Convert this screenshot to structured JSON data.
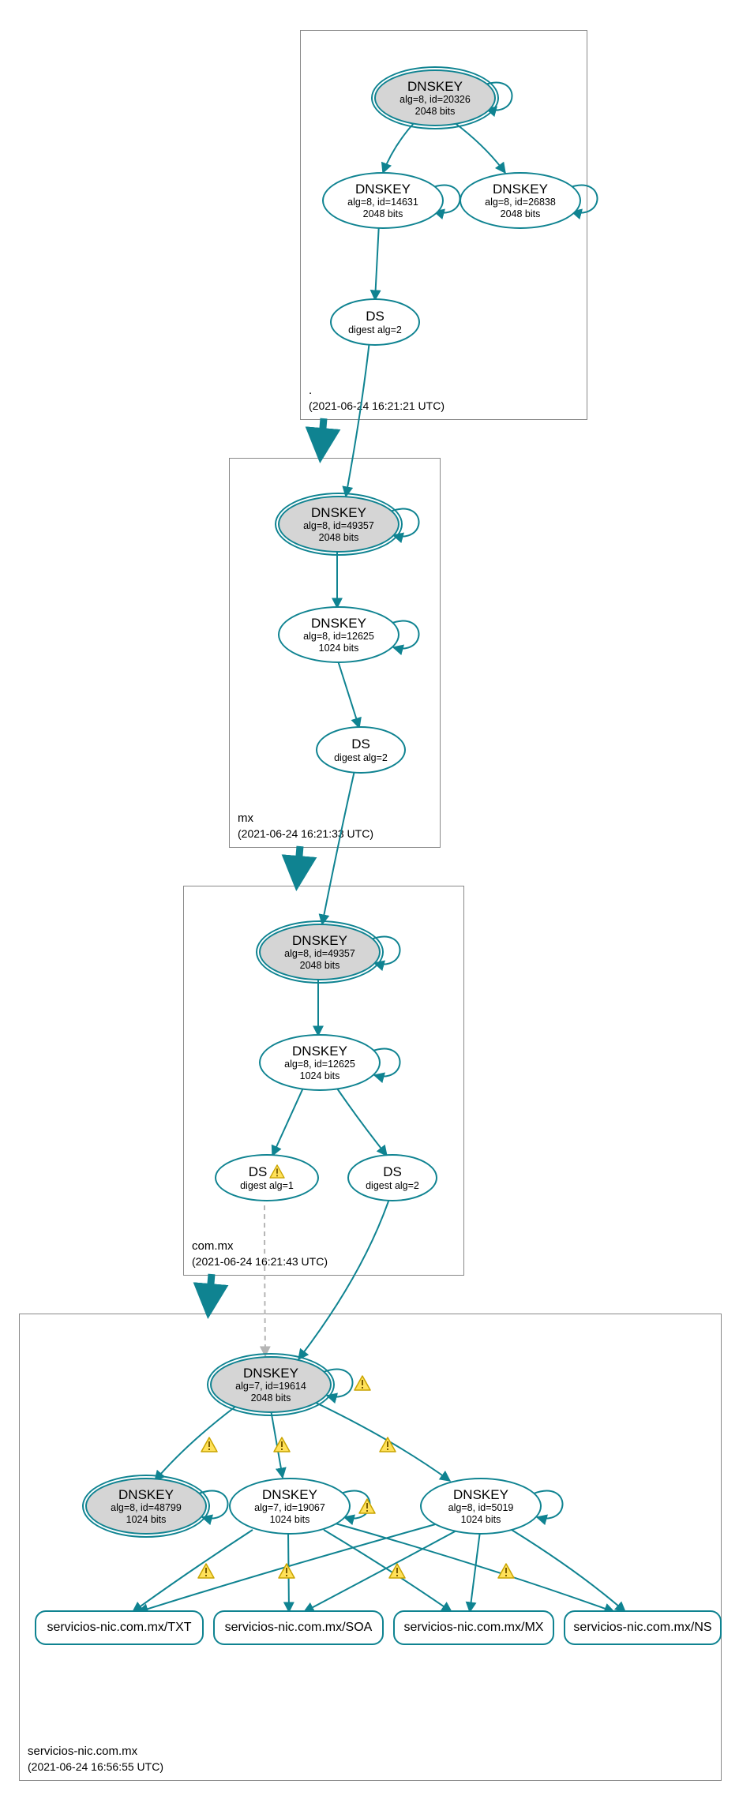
{
  "zones": {
    "root": {
      "name": ".",
      "time": "(2021-06-24 16:21:21 UTC)"
    },
    "mx": {
      "name": "mx",
      "time": "(2021-06-24 16:21:33 UTC)"
    },
    "commx": {
      "name": "com.mx",
      "time": "(2021-06-24 16:21:43 UTC)"
    },
    "leaf": {
      "name": "servicios-nic.com.mx",
      "time": "(2021-06-24 16:56:55 UTC)"
    }
  },
  "nodes": {
    "root_ksk": {
      "title": "DNSKEY",
      "line2": "alg=8, id=20326",
      "line3": "2048 bits"
    },
    "root_zsk1": {
      "title": "DNSKEY",
      "line2": "alg=8, id=14631",
      "line3": "2048 bits"
    },
    "root_zsk2": {
      "title": "DNSKEY",
      "line2": "alg=8, id=26838",
      "line3": "2048 bits"
    },
    "root_ds": {
      "title": "DS",
      "line2": "digest alg=2"
    },
    "mx_ksk": {
      "title": "DNSKEY",
      "line2": "alg=8, id=49357",
      "line3": "2048 bits"
    },
    "mx_zsk": {
      "title": "DNSKEY",
      "line2": "alg=8, id=12625",
      "line3": "1024 bits"
    },
    "mx_ds": {
      "title": "DS",
      "line2": "digest alg=2"
    },
    "commx_ksk": {
      "title": "DNSKEY",
      "line2": "alg=8, id=49357",
      "line3": "2048 bits"
    },
    "commx_zsk": {
      "title": "DNSKEY",
      "line2": "alg=8, id=12625",
      "line3": "1024 bits"
    },
    "commx_ds1": {
      "title": "DS",
      "line2": "digest alg=1",
      "warn": true
    },
    "commx_ds2": {
      "title": "DS",
      "line2": "digest alg=2"
    },
    "leaf_ksk": {
      "title": "DNSKEY",
      "line2": "alg=7, id=19614",
      "line3": "2048 bits"
    },
    "leaf_k1": {
      "title": "DNSKEY",
      "line2": "alg=8, id=48799",
      "line3": "1024 bits"
    },
    "leaf_k2": {
      "title": "DNSKEY",
      "line2": "alg=7, id=19067",
      "line3": "1024 bits"
    },
    "leaf_k3": {
      "title": "DNSKEY",
      "line2": "alg=8, id=5019",
      "line3": "1024 bits"
    },
    "rec_txt": {
      "title": "servicios-nic.com.mx/TXT"
    },
    "rec_soa": {
      "title": "servicios-nic.com.mx/SOA"
    },
    "rec_mx": {
      "title": "servicios-nic.com.mx/MX"
    },
    "rec_ns": {
      "title": "servicios-nic.com.mx/NS"
    }
  },
  "colors": {
    "teal": "#0f8391",
    "gray": "#b5b5b5",
    "warn_fill": "#ffe15a",
    "warn_stroke": "#c9a400"
  },
  "chart_data": {
    "type": "graph",
    "description": "DNSSEC authentication chain / delegation graph",
    "zones": [
      {
        "name": ".",
        "timestamp": "2021-06-24 16:21:21 UTC"
      },
      {
        "name": "mx",
        "timestamp": "2021-06-24 16:21:33 UTC"
      },
      {
        "name": "com.mx",
        "timestamp": "2021-06-24 16:21:43 UTC"
      },
      {
        "name": "servicios-nic.com.mx",
        "timestamp": "2021-06-24 16:56:55 UTC"
      }
    ],
    "nodes": [
      {
        "id": "root_ksk",
        "zone": ".",
        "type": "DNSKEY",
        "alg": 8,
        "key_id": 20326,
        "bits": 2048,
        "ksk": true
      },
      {
        "id": "root_zsk1",
        "zone": ".",
        "type": "DNSKEY",
        "alg": 8,
        "key_id": 14631,
        "bits": 2048
      },
      {
        "id": "root_zsk2",
        "zone": ".",
        "type": "DNSKEY",
        "alg": 8,
        "key_id": 26838,
        "bits": 2048
      },
      {
        "id": "root_ds",
        "zone": ".",
        "type": "DS",
        "digest_alg": 2
      },
      {
        "id": "mx_ksk",
        "zone": "mx",
        "type": "DNSKEY",
        "alg": 8,
        "key_id": 49357,
        "bits": 2048,
        "ksk": true
      },
      {
        "id": "mx_zsk",
        "zone": "mx",
        "type": "DNSKEY",
        "alg": 8,
        "key_id": 12625,
        "bits": 1024
      },
      {
        "id": "mx_ds",
        "zone": "mx",
        "type": "DS",
        "digest_alg": 2
      },
      {
        "id": "commx_ksk",
        "zone": "com.mx",
        "type": "DNSKEY",
        "alg": 8,
        "key_id": 49357,
        "bits": 2048,
        "ksk": true
      },
      {
        "id": "commx_zsk",
        "zone": "com.mx",
        "type": "DNSKEY",
        "alg": 8,
        "key_id": 12625,
        "bits": 1024
      },
      {
        "id": "commx_ds1",
        "zone": "com.mx",
        "type": "DS",
        "digest_alg": 1,
        "warning": true
      },
      {
        "id": "commx_ds2",
        "zone": "com.mx",
        "type": "DS",
        "digest_alg": 2
      },
      {
        "id": "leaf_ksk",
        "zone": "servicios-nic.com.mx",
        "type": "DNSKEY",
        "alg": 7,
        "key_id": 19614,
        "bits": 2048,
        "ksk": true
      },
      {
        "id": "leaf_k1",
        "zone": "servicios-nic.com.mx",
        "type": "DNSKEY",
        "alg": 8,
        "key_id": 48799,
        "bits": 1024,
        "ksk_style": true
      },
      {
        "id": "leaf_k2",
        "zone": "servicios-nic.com.mx",
        "type": "DNSKEY",
        "alg": 7,
        "key_id": 19067,
        "bits": 1024
      },
      {
        "id": "leaf_k3",
        "zone": "servicios-nic.com.mx",
        "type": "DNSKEY",
        "alg": 8,
        "key_id": 5019,
        "bits": 1024
      },
      {
        "id": "rec_txt",
        "zone": "servicios-nic.com.mx",
        "type": "RRset",
        "name": "servicios-nic.com.mx/TXT"
      },
      {
        "id": "rec_soa",
        "zone": "servicios-nic.com.mx",
        "type": "RRset",
        "name": "servicios-nic.com.mx/SOA"
      },
      {
        "id": "rec_mx",
        "zone": "servicios-nic.com.mx",
        "type": "RRset",
        "name": "servicios-nic.com.mx/MX"
      },
      {
        "id": "rec_ns",
        "zone": "servicios-nic.com.mx",
        "type": "RRset",
        "name": "servicios-nic.com.mx/NS"
      }
    ],
    "self_loops": [
      "root_ksk",
      "root_zsk1",
      "root_zsk2",
      "mx_ksk",
      "mx_zsk",
      "commx_ksk",
      "commx_zsk",
      "leaf_ksk",
      "leaf_k1",
      "leaf_k2",
      "leaf_k3"
    ],
    "edges": [
      {
        "from": "root_ksk",
        "to": "root_zsk1"
      },
      {
        "from": "root_ksk",
        "to": "root_zsk2"
      },
      {
        "from": "root_zsk1",
        "to": "root_ds"
      },
      {
        "from": "root_ds",
        "to": "mx_ksk"
      },
      {
        "from": "mx_ksk",
        "to": "mx_zsk"
      },
      {
        "from": "mx_zsk",
        "to": "mx_ds"
      },
      {
        "from": "mx_ds",
        "to": "commx_ksk"
      },
      {
        "from": "commx_ksk",
        "to": "commx_zsk"
      },
      {
        "from": "commx_zsk",
        "to": "commx_ds1"
      },
      {
        "from": "commx_zsk",
        "to": "commx_ds2"
      },
      {
        "from": "commx_ds1",
        "to": "leaf_ksk",
        "style": "dashed-gray"
      },
      {
        "from": "commx_ds2",
        "to": "leaf_ksk"
      },
      {
        "from": "leaf_ksk",
        "to": "leaf_k1",
        "warning": true
      },
      {
        "from": "leaf_ksk",
        "to": "leaf_k2",
        "warning": true
      },
      {
        "from": "leaf_ksk",
        "to": "leaf_k3",
        "warning": true
      },
      {
        "from": "leaf_k2",
        "to": "rec_txt",
        "warning": true
      },
      {
        "from": "leaf_k2",
        "to": "rec_soa",
        "warning": true
      },
      {
        "from": "leaf_k2",
        "to": "rec_mx",
        "warning": true
      },
      {
        "from": "leaf_k2",
        "to": "rec_ns",
        "warning": true
      },
      {
        "from": "leaf_k3",
        "to": "rec_txt"
      },
      {
        "from": "leaf_k3",
        "to": "rec_soa"
      },
      {
        "from": "leaf_k3",
        "to": "rec_mx"
      },
      {
        "from": "leaf_k3",
        "to": "rec_ns"
      }
    ],
    "delegations": [
      {
        "from_zone": ".",
        "to_zone": "mx"
      },
      {
        "from_zone": "mx",
        "to_zone": "com.mx"
      },
      {
        "from_zone": "com.mx",
        "to_zone": "servicios-nic.com.mx"
      }
    ]
  }
}
